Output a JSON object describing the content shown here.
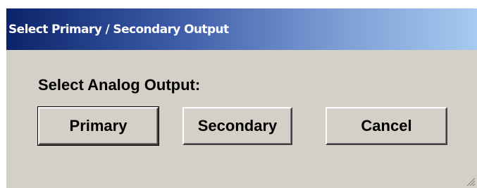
{
  "window": {
    "title": "Select Primary / Secondary Output"
  },
  "main": {
    "prompt": "Select Analog Output:"
  },
  "buttons": {
    "primary_label": "Primary",
    "secondary_label": "Secondary",
    "cancel_label": "Cancel"
  },
  "icons": {
    "resize_grip": "resize-grip-icon"
  },
  "colors": {
    "titlebar_start": "#0a246a",
    "titlebar_end": "#a6caf0",
    "dialog_background": "#d4d0c8"
  }
}
